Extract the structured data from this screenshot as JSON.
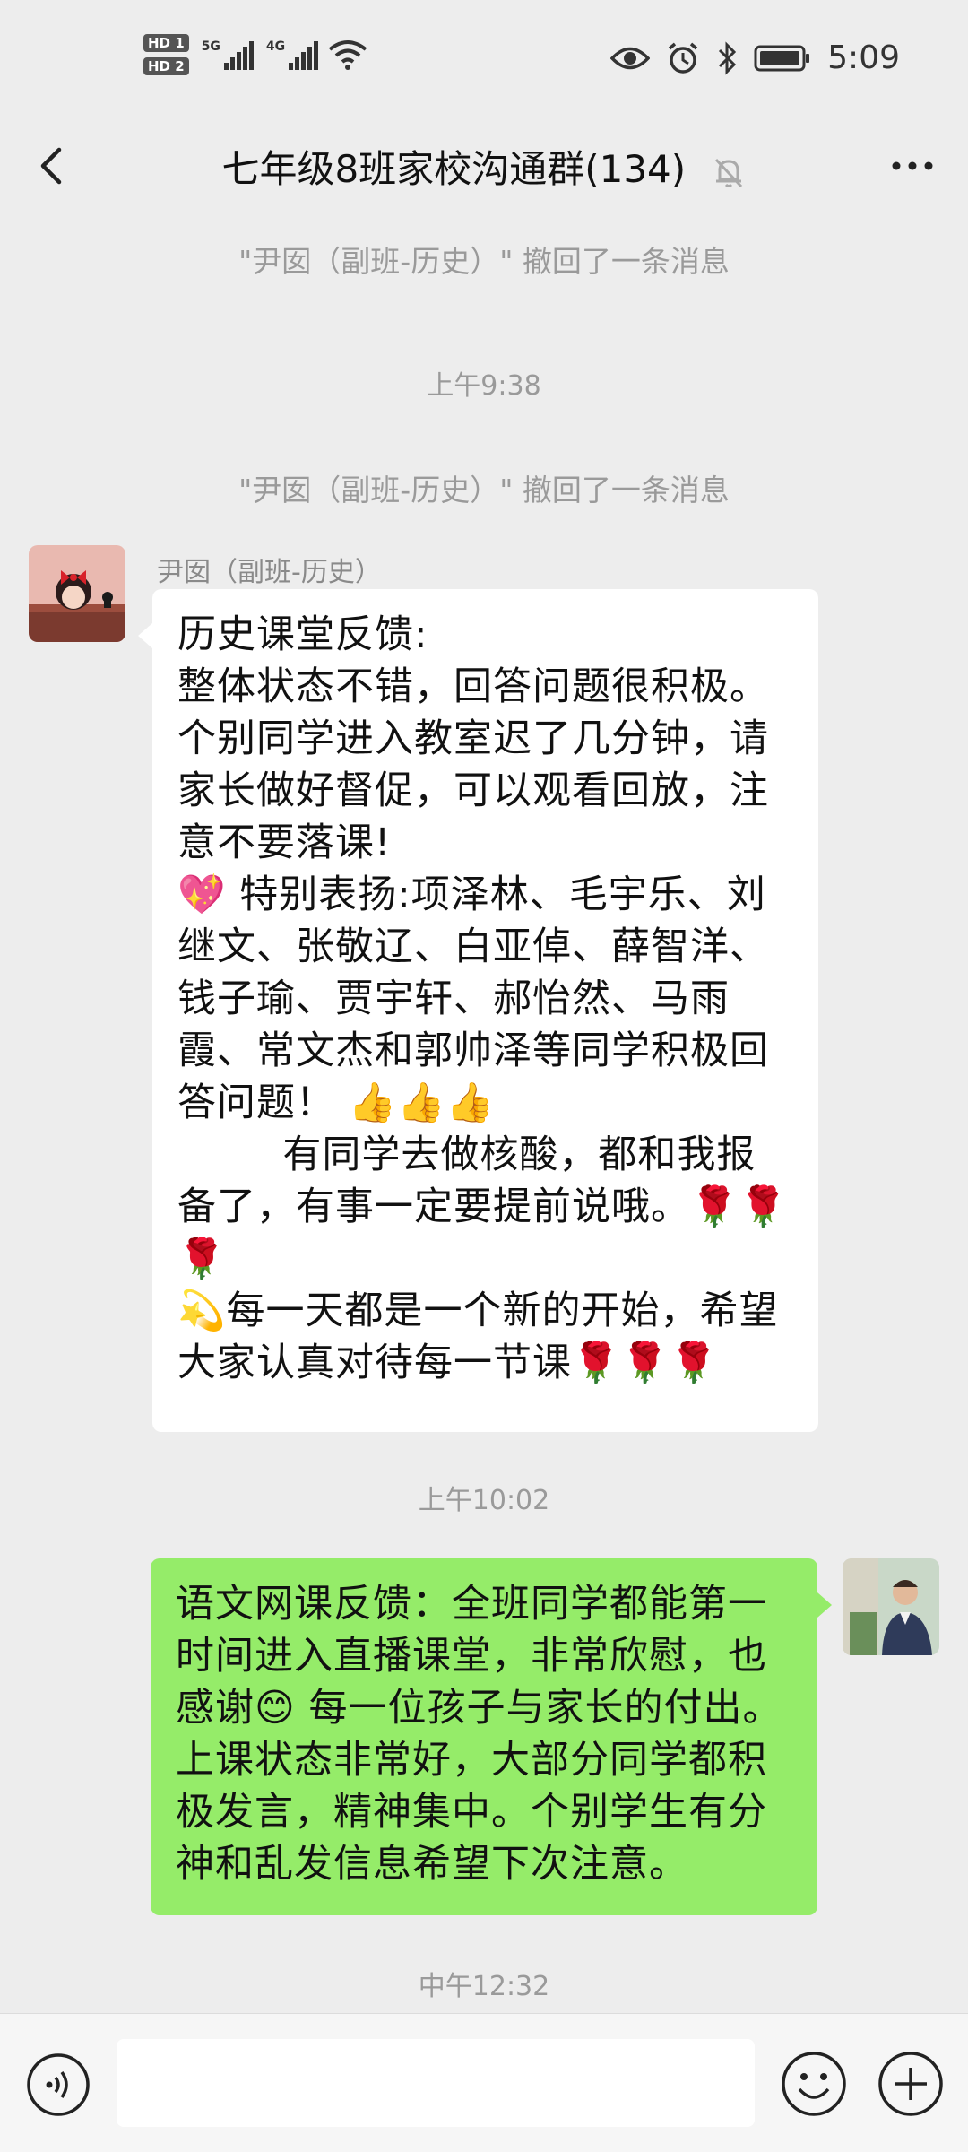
{
  "status_bar": {
    "hd1": "HD 1",
    "hd2": "HD 2",
    "net1": "5G",
    "net2": "4G",
    "time": "5:09"
  },
  "header": {
    "title": "七年级8班家校沟通群(134)",
    "back_icon": "chevron-left-icon",
    "mute_icon": "bell-off-icon",
    "more_icon": "more-dots-icon"
  },
  "messages": {
    "sys1": "\"尹囡（副班-历史）\" 撤回了一条消息",
    "ts1": "上午9:38",
    "sys2": "\"尹囡（副班-历史）\" 撤回了一条消息",
    "msg1": {
      "sender": "尹囡（副班-历史）",
      "text": "历史课堂反馈:\n整体状态不错，回答问题很积极。个别同学进入教室迟了几分钟，请家长做好督促，可以观看回放，注意不要落课!\n💖 特别表扬:项泽林、毛宇乐、刘继文、张敬辽、白亚倬、薛智洋、钱子瑜、贾宇轩、郝怡然、马雨霞、常文杰和郭帅泽等同学积极回答问题！ 👍👍👍\n        有同学去做核酸，都和我报备了，有事一定要提前说哦。🌹🌹🌹\n💫每一天都是一个新的开始，希望大家认真对待每一节课🌹🌹🌹"
    },
    "ts2": "上午10:02",
    "msg2": {
      "text": "语文网课反馈：全班同学都能第一时间进入直播课堂，非常欣慰，也感谢😊 每一位孩子与家长的付出。上课状态非常好，大部分同学都积极发言，精神集中。个别学生有分神和乱发信息希望下次注意。"
    },
    "ts3": "中午12:32"
  },
  "input_bar": {
    "voice_icon": "voice-icon",
    "emoji_icon": "emoji-icon",
    "plus_icon": "plus-circle-icon",
    "placeholder": ""
  },
  "colors": {
    "background": "#ededed",
    "incoming_bubble": "#ffffff",
    "outgoing_bubble": "#95ec69"
  }
}
